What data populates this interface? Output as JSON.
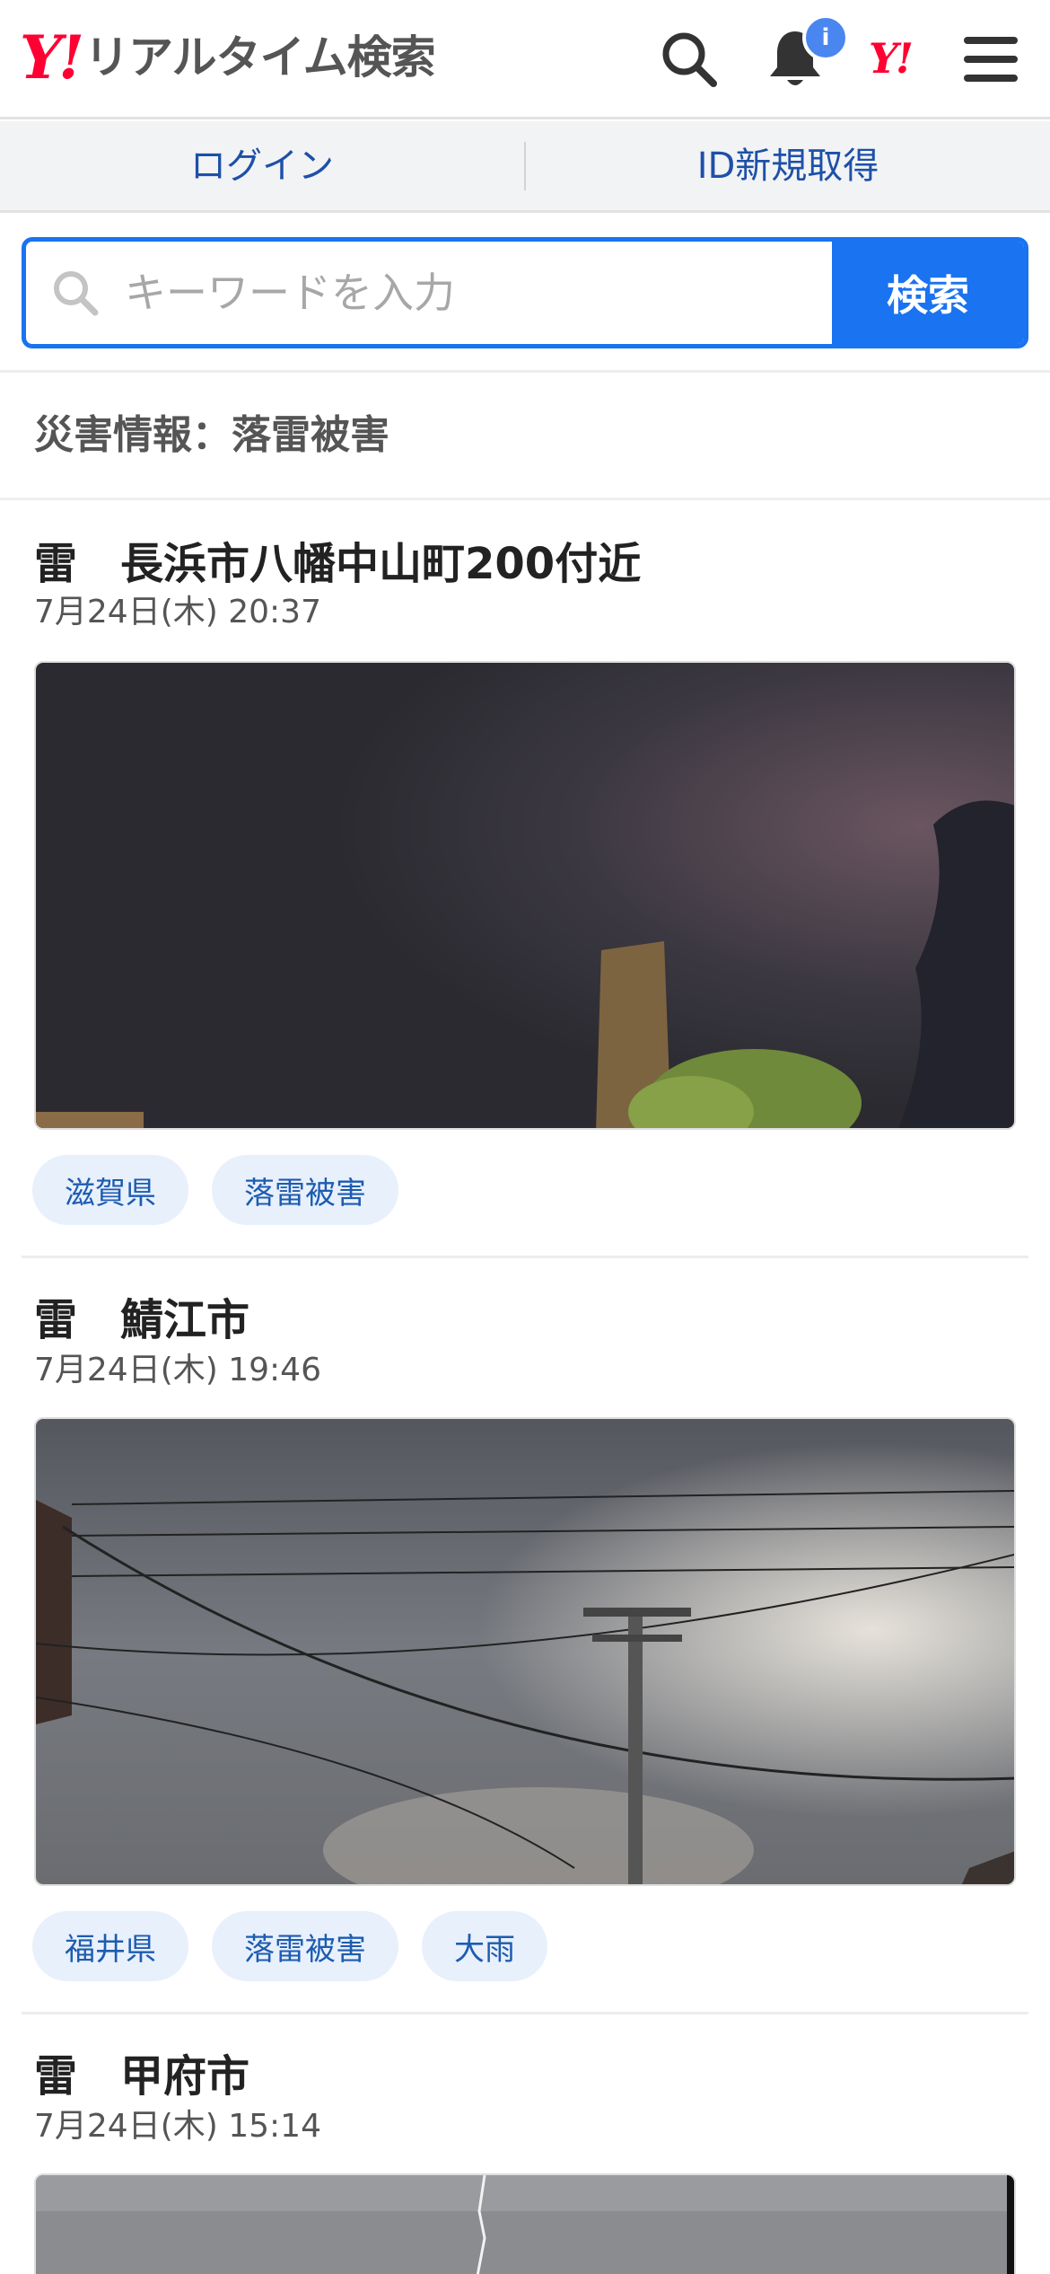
{
  "header": {
    "logo_mark": "Y!",
    "logo_text": "リアルタイム検索",
    "notification_badge": "i",
    "yahoo_mark": "Y!"
  },
  "loginbar": {
    "login": "ログイン",
    "register": "ID新規取得"
  },
  "search": {
    "placeholder": "キーワードを入力",
    "button": "検索"
  },
  "section": {
    "title": "災害情報：落雷被害"
  },
  "articles": [
    {
      "title": "雷　長浜市八幡中山町200付近",
      "date": "7月24日(木) 20:37",
      "tags": [
        "滋賀県",
        "落雷被害"
      ]
    },
    {
      "title": "雷　鯖江市",
      "date": "7月24日(木) 19:46",
      "tags": [
        "福井県",
        "落雷被害",
        "大雨"
      ]
    },
    {
      "title": "雷　甲府市",
      "date": "7月24日(木) 15:14",
      "tags": []
    }
  ],
  "icons": {
    "search": "search-icon",
    "bell": "bell-icon",
    "menu": "hamburger-menu-icon"
  },
  "colors": {
    "brand_red": "#ff0033",
    "accent_blue": "#1a73f0",
    "link_blue": "#1d50a8",
    "tag_bg": "#e8f0fc"
  }
}
